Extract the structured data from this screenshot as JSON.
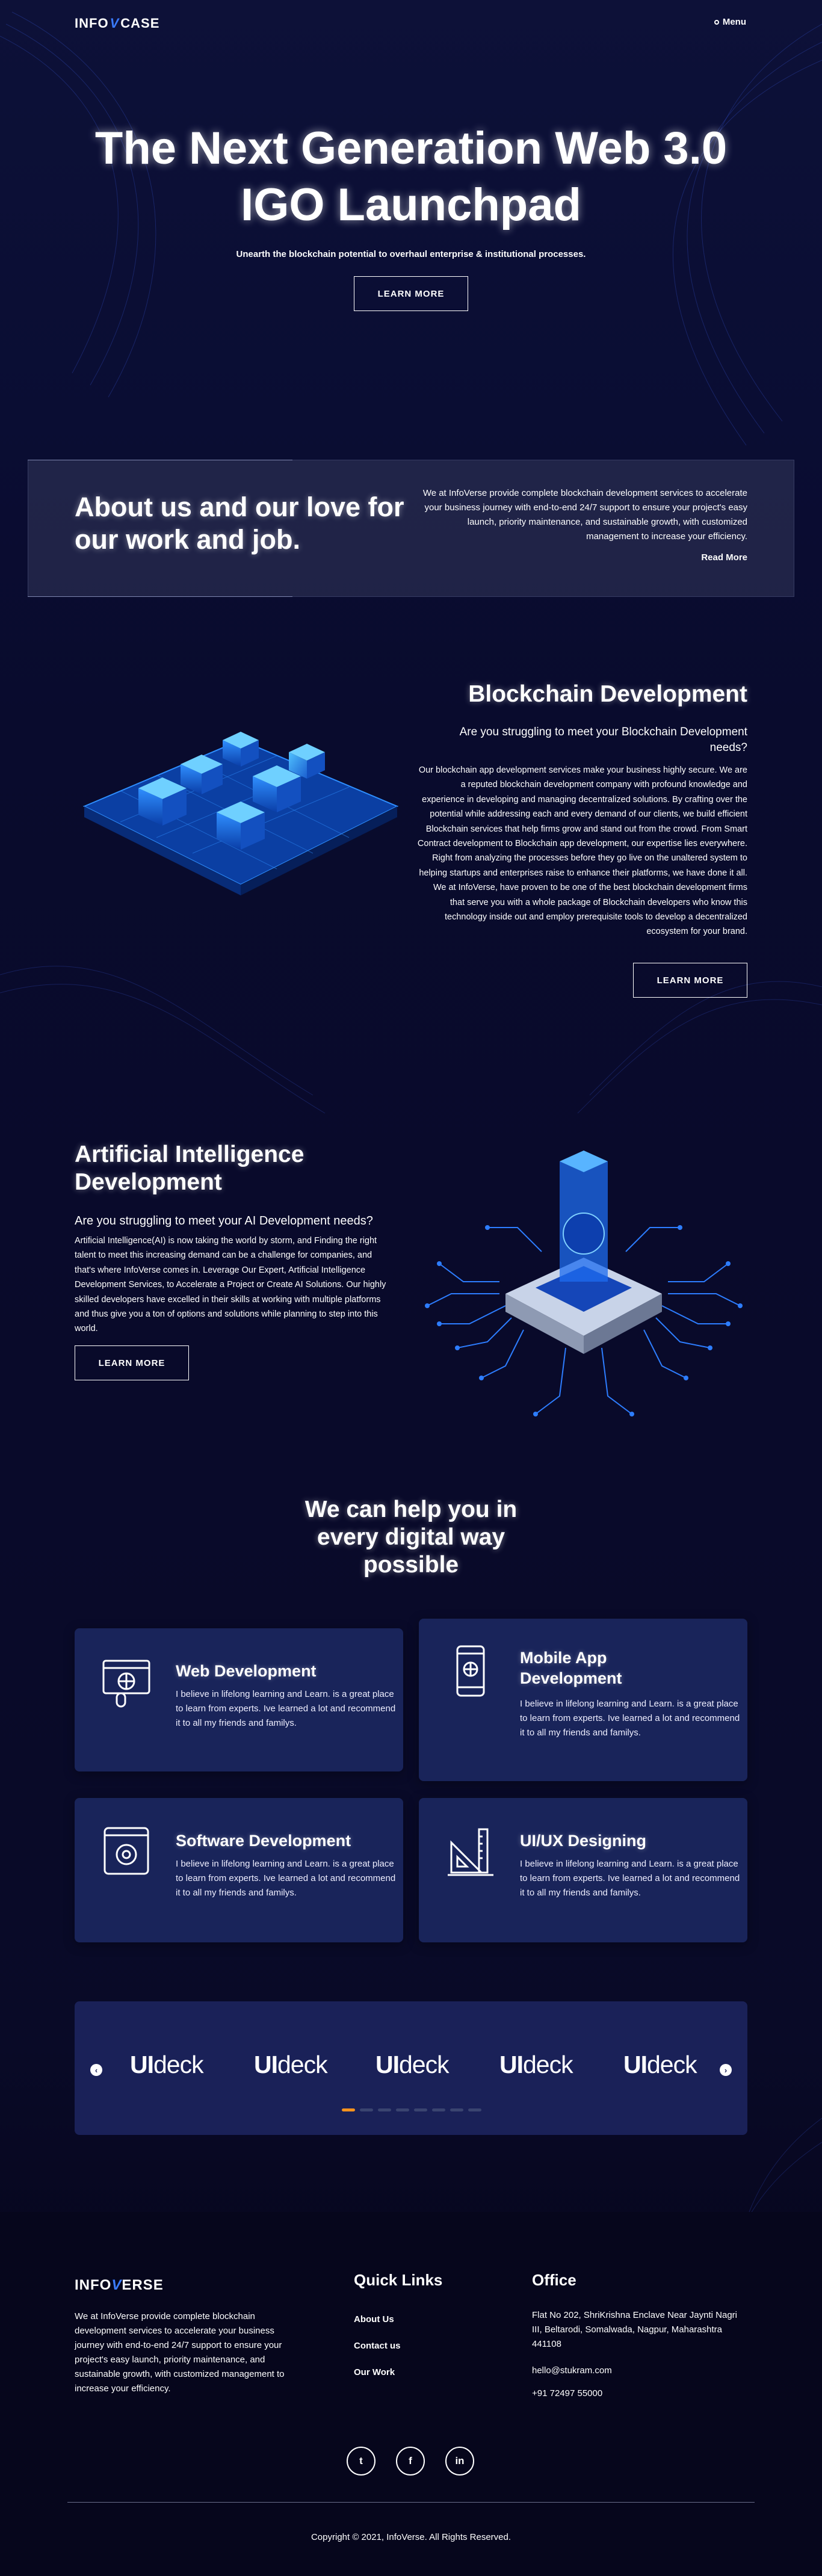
{
  "header": {
    "logo_left": "INFO",
    "logo_v": "V",
    "logo_right": "CASE",
    "menu_label": "Menu"
  },
  "hero": {
    "title_line1": "The Next Generation Web 3.0",
    "title_line2": "IGO Launchpad",
    "subtitle": "Unearth the blockchain potential to overhaul enterprise & institutional processes.",
    "button": "LEARN MORE"
  },
  "about": {
    "title": "About us and our love for our work and job.",
    "text": "We at InfoVerse provide complete blockchain development services to accelerate your business journey with end-to-end 24/7 support to ensure your project's easy launch, priority maintenance, and sustainable growth, with customized management to increase your efficiency.",
    "read_more": "Read More"
  },
  "blockchain": {
    "title": "Blockchain Development",
    "question": "Are you struggling to meet your Blockchain Development needs?",
    "text": "Our blockchain app development services make your business highly secure. We are a reputed blockchain development company with profound knowledge and experience in developing and managing decentralized solutions. By crafting over the potential while addressing each and every demand of our clients, we build efficient Blockchain services that help firms grow and stand out from the crowd. From Smart Contract development to Blockchain app development, our expertise lies everywhere. Right from analyzing the processes before they go live on the unaltered system to helping startups and enterprises raise to enhance their platforms, we have done it all. We at InfoVerse, have proven to be one of the best blockchain development firms that serve you with a whole package of Blockchain developers who know this technology inside out and employ prerequisite tools to develop a decentralized ecosystem for your brand.",
    "button": "LEARN MORE"
  },
  "ai": {
    "title": "Artificial Intelligence Development",
    "question": "Are you struggling to meet your AI Development needs?",
    "text": "Artificial Intelligence(AI) is now taking the world by storm, and Finding the right talent to meet this increasing demand can be a challenge for companies, and that's where InfoVerse comes in. Leverage Our Expert, Artificial Intelligence Development Services, to Accelerate a Project or Create AI Solutions. Our highly skilled developers have excelled in their skills at working with multiple platforms and thus give you a ton of options and solutions while planning to step into this world.",
    "button": "LEARN MORE"
  },
  "services": {
    "title": "We can help you in every digital way possible",
    "cards": [
      {
        "title": "Web Development",
        "icon": "web-development-icon",
        "text": "I believe in lifelong learning and Learn. is a great place to learn from experts. Ive learned a lot and recommend it to all my friends and familys."
      },
      {
        "title": "Mobile App Development",
        "icon": "mobile-app-icon",
        "text": "I believe in lifelong learning and Learn. is a great place to learn from experts. Ive learned a lot and recommend it to all my friends and familys."
      },
      {
        "title": "Software Development",
        "icon": "software-development-icon",
        "text": "I believe in lifelong learning and Learn. is a great place to learn from experts. Ive learned a lot and recommend it to all my friends and familys."
      },
      {
        "title": "UI/UX Designing",
        "icon": "ui-ux-design-icon",
        "text": "I believe in lifelong learning and Learn. is a great place to learn from experts. Ive learned a lot and recommend it to all my friends and familys."
      }
    ]
  },
  "brands": {
    "logos": [
      {
        "a": "UI",
        "b": "deck"
      },
      {
        "a": "UI",
        "b": "deck"
      },
      {
        "a": "UI",
        "b": "deck"
      },
      {
        "a": "UI",
        "b": "deck"
      },
      {
        "a": "UI",
        "b": "deck"
      }
    ],
    "prev": "‹",
    "next": "›",
    "active_dot": 0,
    "dot_count": 8
  },
  "footer": {
    "logo_left": "INFO",
    "logo_v": "V",
    "logo_right": "ERSE",
    "about": "We at InfoVerse provide complete blockchain development services to accelerate your business journey with end-to-end 24/7 support to ensure your project's easy launch, priority maintenance, and sustainable growth, with customized management to increase your efficiency.",
    "quick_links_title": "Quick Links",
    "links": [
      "About Us",
      "Contact us",
      "Our Work"
    ],
    "office_title": "Office",
    "address": "Flat No 202, ShriKrishna Enclave Near Jaynti Nagri III, Beltarodi, Somalwada, Nagpur, Maharashtra 441108",
    "email": "hello@stukram.com",
    "phone": "+91 72497 55000",
    "social": [
      "t",
      "f",
      "in"
    ],
    "copyright": "Copyright © 2021, InfoVerse. All Rights Reserved."
  },
  "colors": {
    "background": "#0a0d33",
    "card": "#19245a",
    "accent": "#3a7bff",
    "dot_active": "#f7931e"
  }
}
